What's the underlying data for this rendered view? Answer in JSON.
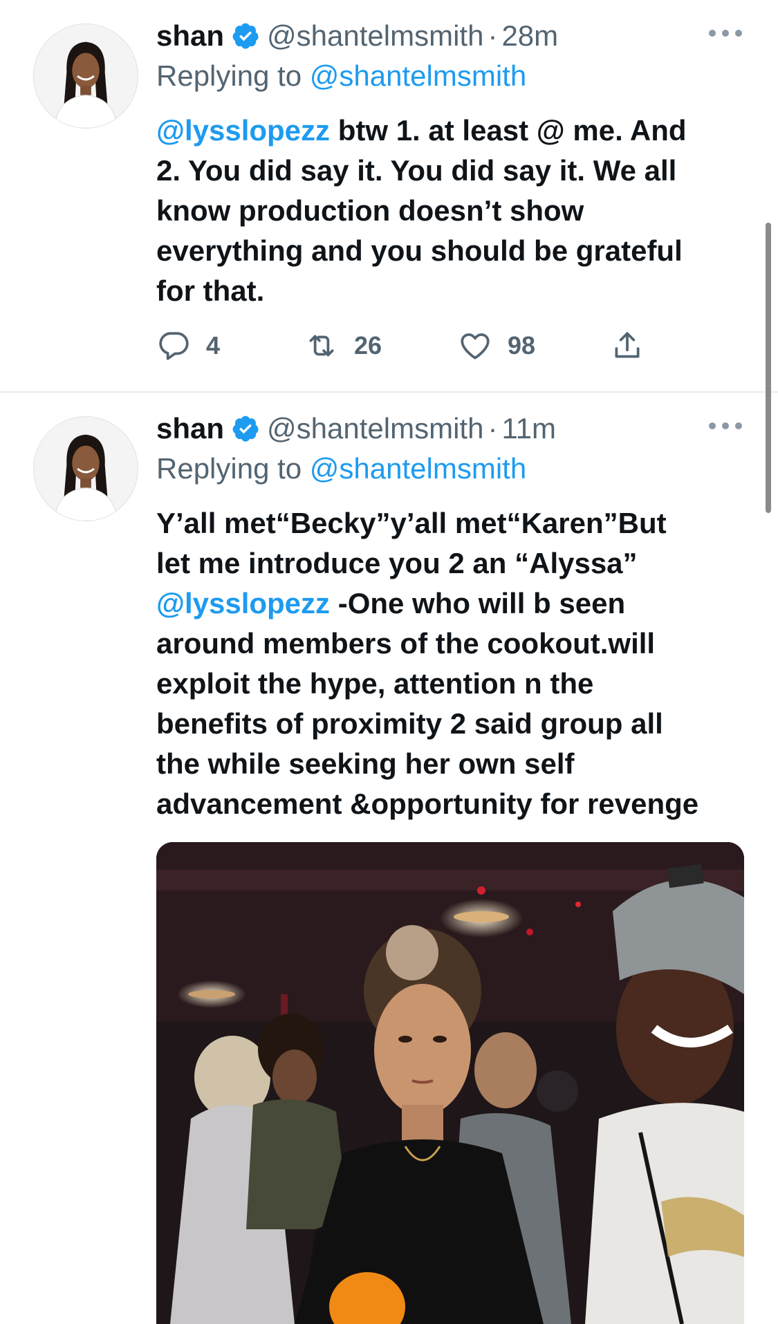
{
  "tweets": [
    {
      "author_name": "shan",
      "handle": "@shantelmsmith",
      "separator": "·",
      "time": "28m",
      "replying_prefix": "Replying to ",
      "replying_to": "@shantelmsmith",
      "lines": [
        [
          {
            "t": "@lysslopezz",
            "m": true
          },
          {
            "t": " btw 1. at least @ me. And",
            "m": false
          }
        ],
        [
          {
            "t": "2. You did say it. You did say it. We all",
            "m": false
          }
        ],
        [
          {
            "t": "know production doesn’t show",
            "m": false
          }
        ],
        [
          {
            "t": "everything and you should be grateful",
            "m": false
          }
        ],
        [
          {
            "t": "for that.",
            "m": false
          }
        ]
      ],
      "stats": {
        "replies": "4",
        "retweets": "26",
        "likes": "98"
      }
    },
    {
      "author_name": "shan",
      "handle": "@shantelmsmith",
      "separator": "·",
      "time": "11m",
      "replying_prefix": "Replying to ",
      "replying_to": "@shantelmsmith",
      "lines": [
        [
          {
            "t": "Y’all met“Becky”y’all met“Karen”But",
            "m": false
          }
        ],
        [
          {
            "t": "let me introduce you 2 an “Alyssa”",
            "m": false
          }
        ],
        [
          {
            "t": "@lysslopezz",
            "m": true
          },
          {
            "t": "  -One who will b seen",
            "m": false
          }
        ],
        [
          {
            "t": "around members of the cookout.will",
            "m": false
          }
        ],
        [
          {
            "t": "exploit the hype, attention n the",
            "m": false
          }
        ],
        [
          {
            "t": "benefits of proximity 2 said group all",
            "m": false
          }
        ],
        [
          {
            "t": "the while seeking her own self",
            "m": false
          }
        ],
        [
          {
            "t": "advancement &opportunity for revenge",
            "m": false
          }
        ]
      ]
    }
  ],
  "colors": {
    "link": "#1d9bf0",
    "secondary_text": "#536471",
    "primary_text": "#0f1419",
    "divider": "#e6ecf0"
  },
  "icons": {
    "verified": "verified-badge-icon",
    "more": "more-options-icon",
    "reply": "reply-bubble-icon",
    "retweet": "retweet-icon",
    "like": "heart-icon",
    "share": "share-upload-icon"
  }
}
